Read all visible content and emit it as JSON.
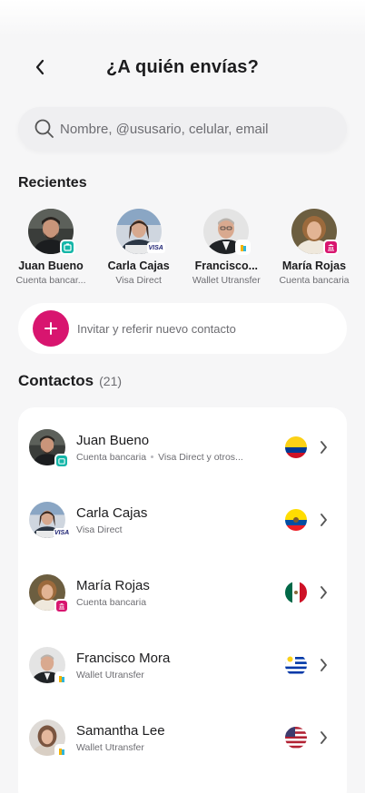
{
  "header": {
    "title": "¿A quién envías?"
  },
  "search": {
    "placeholder": "Nombre, @ususario, celular, email"
  },
  "recents": {
    "title": "Recientes",
    "items": [
      {
        "name": "Juan Bueno",
        "sub": "Cuenta bancar...",
        "badge": "bank"
      },
      {
        "name": "Carla Cajas",
        "sub": "Visa Direct",
        "badge": "visa"
      },
      {
        "name": "Francisco...",
        "sub": "Wallet Utransfer",
        "badge": "wallet"
      },
      {
        "name": "María Rojas",
        "sub": "Cuenta bancaria",
        "badge": "cash"
      }
    ]
  },
  "invite": {
    "label": "Invitar y referir nuevo contacto"
  },
  "contacts": {
    "title": "Contactos",
    "count": "(21)",
    "items": [
      {
        "name": "Juan Bueno",
        "sub": "Cuenta bancaria",
        "sub2": "Visa Direct y otros...",
        "flag": "Colombia",
        "badge": "bank"
      },
      {
        "name": "Carla Cajas",
        "sub": "Visa Direct",
        "flag": "Ecuador",
        "badge": "visa"
      },
      {
        "name": "María Rojas",
        "sub": "Cuenta bancaria",
        "flag": "México",
        "badge": "cash"
      },
      {
        "name": "Francisco Mora",
        "sub": "Wallet Utransfer",
        "flag": "Uruguay",
        "badge": "wallet"
      },
      {
        "name": "Samantha Lee",
        "sub": "Wallet Utransfer",
        "flag": "Estados Unidos",
        "badge": "wallet"
      }
    ]
  },
  "colors": {
    "accent": "#d8156f",
    "bank_badge": "#15b6a8",
    "background": "#f6f6f7"
  }
}
